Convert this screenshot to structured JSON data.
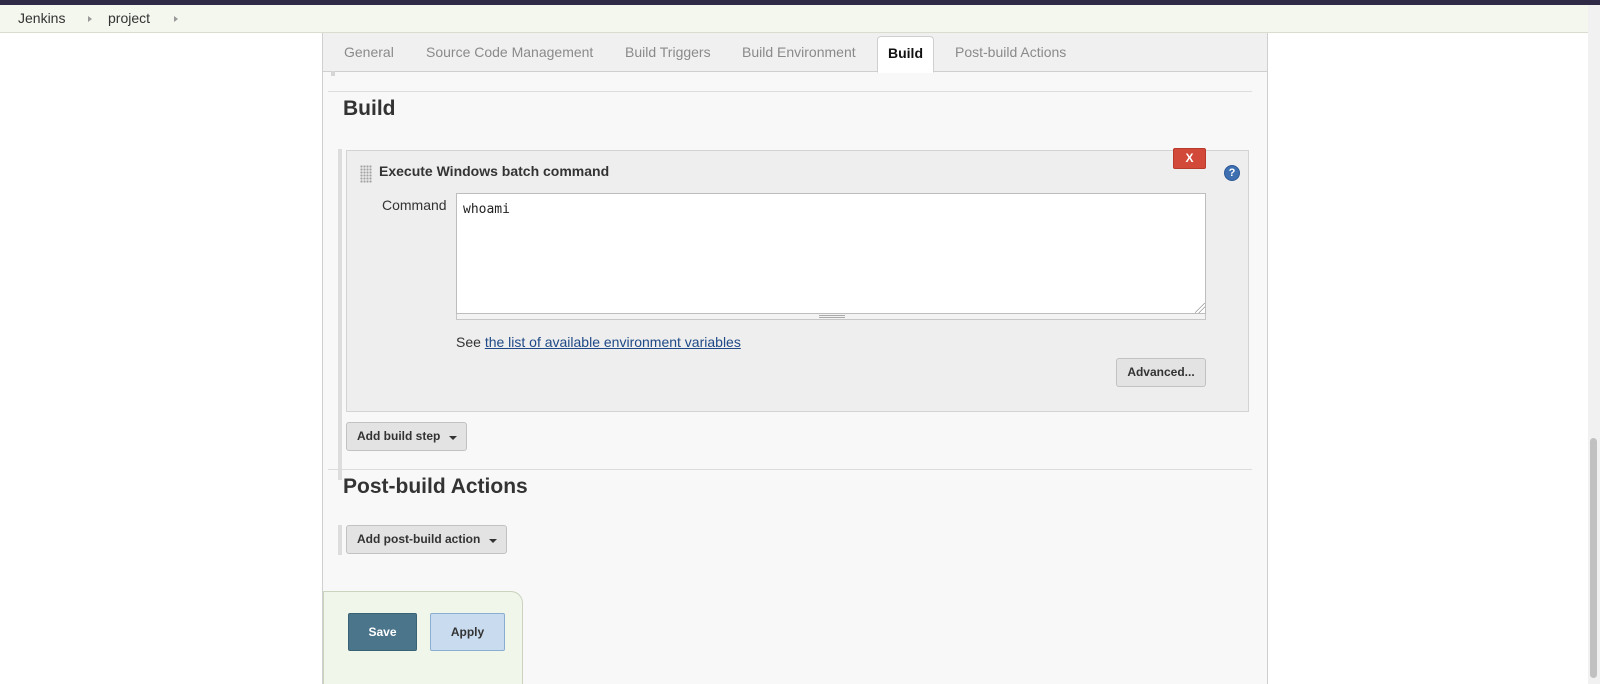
{
  "breadcrumb": {
    "items": [
      {
        "label": "Jenkins"
      },
      {
        "label": "project"
      }
    ]
  },
  "tabs": [
    {
      "label": "General",
      "active": false
    },
    {
      "label": "Source Code Management",
      "active": false
    },
    {
      "label": "Build Triggers",
      "active": false
    },
    {
      "label": "Build Environment",
      "active": false
    },
    {
      "label": "Build",
      "active": true
    },
    {
      "label": "Post-build Actions",
      "active": false
    }
  ],
  "build_section": {
    "title": "Build",
    "step": {
      "title": "Execute Windows batch command",
      "delete_label": "X",
      "help_label": "?",
      "command_label": "Command",
      "command_value": "whoami",
      "env_prefix": "See ",
      "env_link": "the list of available environment variables",
      "advanced_label": "Advanced..."
    },
    "add_step_label": "Add build step"
  },
  "post_build_section": {
    "title": "Post-build Actions",
    "add_action_label": "Add post-build action"
  },
  "footer": {
    "save_label": "Save",
    "apply_label": "Apply"
  },
  "colors": {
    "header_bar": "#2f2a46",
    "breadcrumb_bg": "#f4f7ee",
    "delete_red": "#d24939",
    "save_blue": "#4b758b",
    "apply_blue": "#c9dcef",
    "link": "#204a87"
  },
  "icons": {
    "breadcrumb_separator": "chevron-right-icon",
    "drag": "drag-handle-icon",
    "help": "help-icon",
    "dropdown": "chevron-down-icon"
  }
}
